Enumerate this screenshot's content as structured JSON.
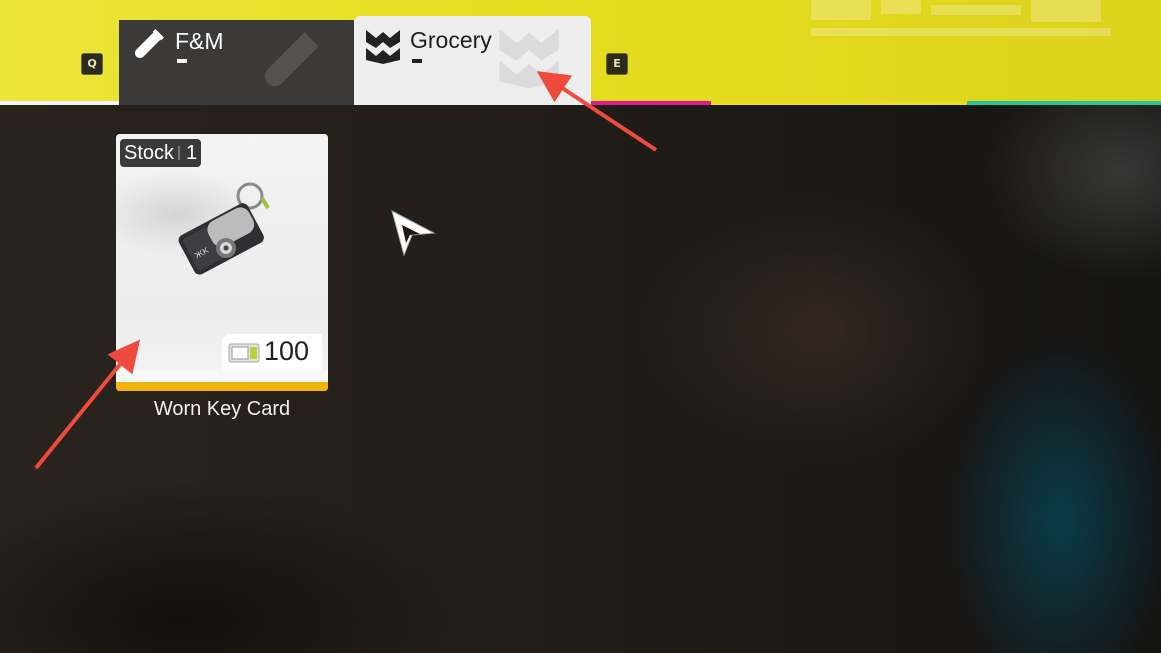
{
  "tabs": [
    {
      "label": "F&M",
      "icon": "test-tube-icon",
      "selected": false
    },
    {
      "label": "Grocery",
      "icon": "grocery-logo-icon",
      "selected": true
    }
  ],
  "hints": {
    "prev_key": "Q",
    "next_key": "E"
  },
  "item": {
    "stock_label": "Stock",
    "stock_count": "1",
    "price": "100",
    "currency_icon": "denny-currency-icon",
    "name": "Worn Key Card"
  },
  "colors": {
    "topbar": "#e7dd1f",
    "annotation_arrow": "#ef4a3c",
    "card_accent": "#f0b40c"
  }
}
